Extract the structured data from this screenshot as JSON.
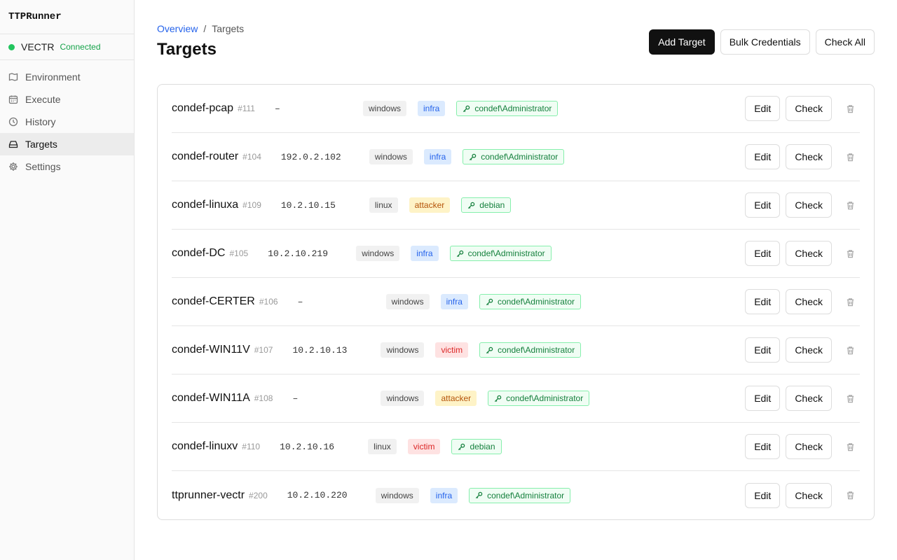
{
  "app": {
    "name": "TTPRunner"
  },
  "connection": {
    "name": "VECTR",
    "status": "Connected",
    "status_color": "#22c55e"
  },
  "nav": [
    {
      "label": "Environment",
      "icon": "map-icon",
      "active": false
    },
    {
      "label": "Execute",
      "icon": "calendar-icon",
      "active": false
    },
    {
      "label": "History",
      "icon": "clock-icon",
      "active": false
    },
    {
      "label": "Targets",
      "icon": "drive-icon",
      "active": true
    },
    {
      "label": "Settings",
      "icon": "gear-icon",
      "active": false
    }
  ],
  "breadcrumb": {
    "parent": "Overview",
    "separator": "/",
    "current": "Targets"
  },
  "page_title": "Targets",
  "actions": {
    "add": "Add Target",
    "bulk": "Bulk Credentials",
    "check_all": "Check All"
  },
  "row_actions": {
    "edit": "Edit",
    "check": "Check"
  },
  "targets": [
    {
      "name": "condef-pcap",
      "id": "#111",
      "ip": "–",
      "os": "windows",
      "role": "infra",
      "cred": "condef\\Administrator"
    },
    {
      "name": "condef-router",
      "id": "#104",
      "ip": "192.0.2.102",
      "os": "windows",
      "role": "infra",
      "cred": "condef\\Administrator"
    },
    {
      "name": "condef-linuxa",
      "id": "#109",
      "ip": "10.2.10.15",
      "os": "linux",
      "role": "attacker",
      "cred": "debian"
    },
    {
      "name": "condef-DC",
      "id": "#105",
      "ip": "10.2.10.219",
      "os": "windows",
      "role": "infra",
      "cred": "condef\\Administrator"
    },
    {
      "name": "condef-CERTER",
      "id": "#106",
      "ip": "–",
      "os": "windows",
      "role": "infra",
      "cred": "condef\\Administrator"
    },
    {
      "name": "condef-WIN11V",
      "id": "#107",
      "ip": "10.2.10.13",
      "os": "windows",
      "role": "victim",
      "cred": "condef\\Administrator"
    },
    {
      "name": "condef-WIN11A",
      "id": "#108",
      "ip": "–",
      "os": "windows",
      "role": "attacker",
      "cred": "condef\\Administrator"
    },
    {
      "name": "condef-linuxv",
      "id": "#110",
      "ip": "10.2.10.16",
      "os": "linux",
      "role": "victim",
      "cred": "debian"
    },
    {
      "name": "ttprunner-vectr",
      "id": "#200",
      "ip": "10.2.10.220",
      "os": "windows",
      "role": "infra",
      "cred": "condef\\Administrator"
    }
  ]
}
